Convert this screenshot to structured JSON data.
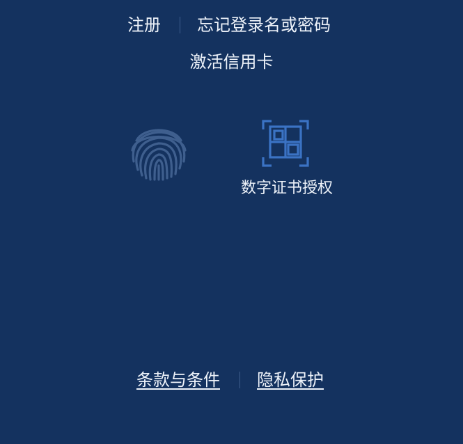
{
  "top_links": {
    "register_label": "注册",
    "forgot_label": "忘记登录名或密码"
  },
  "activate": {
    "label": "激活信用卡"
  },
  "auth_options": {
    "fingerprint_icon": "fingerprint-icon",
    "certificate_icon": "qr-scan-icon",
    "certificate_label": "数字证书授权"
  },
  "footer_links": {
    "terms_label": "条款与条件",
    "privacy_label": "隐私保护"
  },
  "colors": {
    "background": "#14325f",
    "text": "#eef3fa",
    "icon_muted": "#3f5f8e",
    "icon_accent": "#3b73c4"
  }
}
